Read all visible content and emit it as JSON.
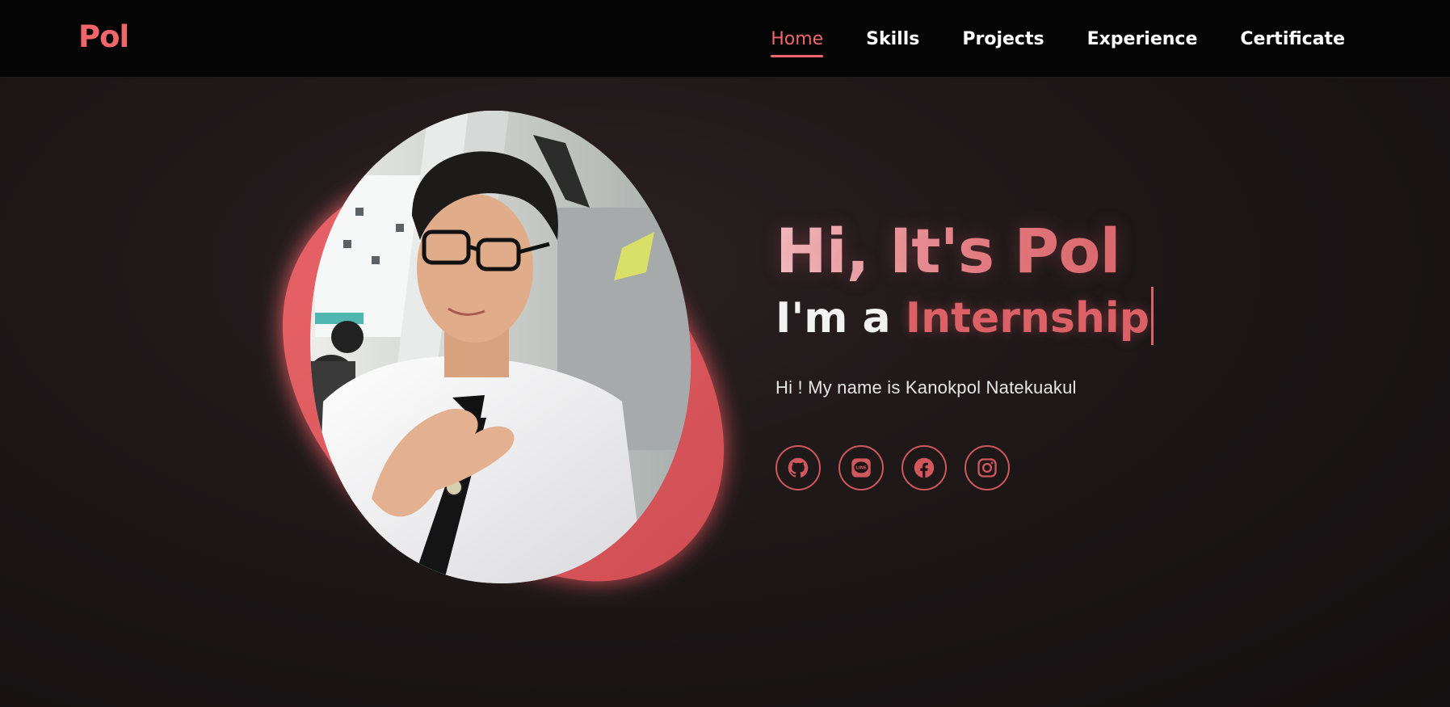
{
  "logo": {
    "text": "Pol"
  },
  "nav": {
    "items": [
      {
        "label": "Home",
        "active": true
      },
      {
        "label": "Skills"
      },
      {
        "label": "Projects"
      },
      {
        "label": "Experience"
      },
      {
        "label": "Certificate"
      }
    ]
  },
  "hero": {
    "greeting": "Hi, It's Pol",
    "role_prefix": "I'm a ",
    "role_word": "Internship",
    "intro": "Hi ! My name is Kanokpol Natekuakul",
    "socials": [
      {
        "icon": "github-icon"
      },
      {
        "icon": "line-icon",
        "label": "LINE"
      },
      {
        "icon": "facebook-icon"
      },
      {
        "icon": "instagram-icon"
      }
    ]
  },
  "colors": {
    "accent": "#f0666a",
    "nav_bg": "#050505",
    "page_bg": "#1b1516",
    "text": "#ffffff"
  }
}
